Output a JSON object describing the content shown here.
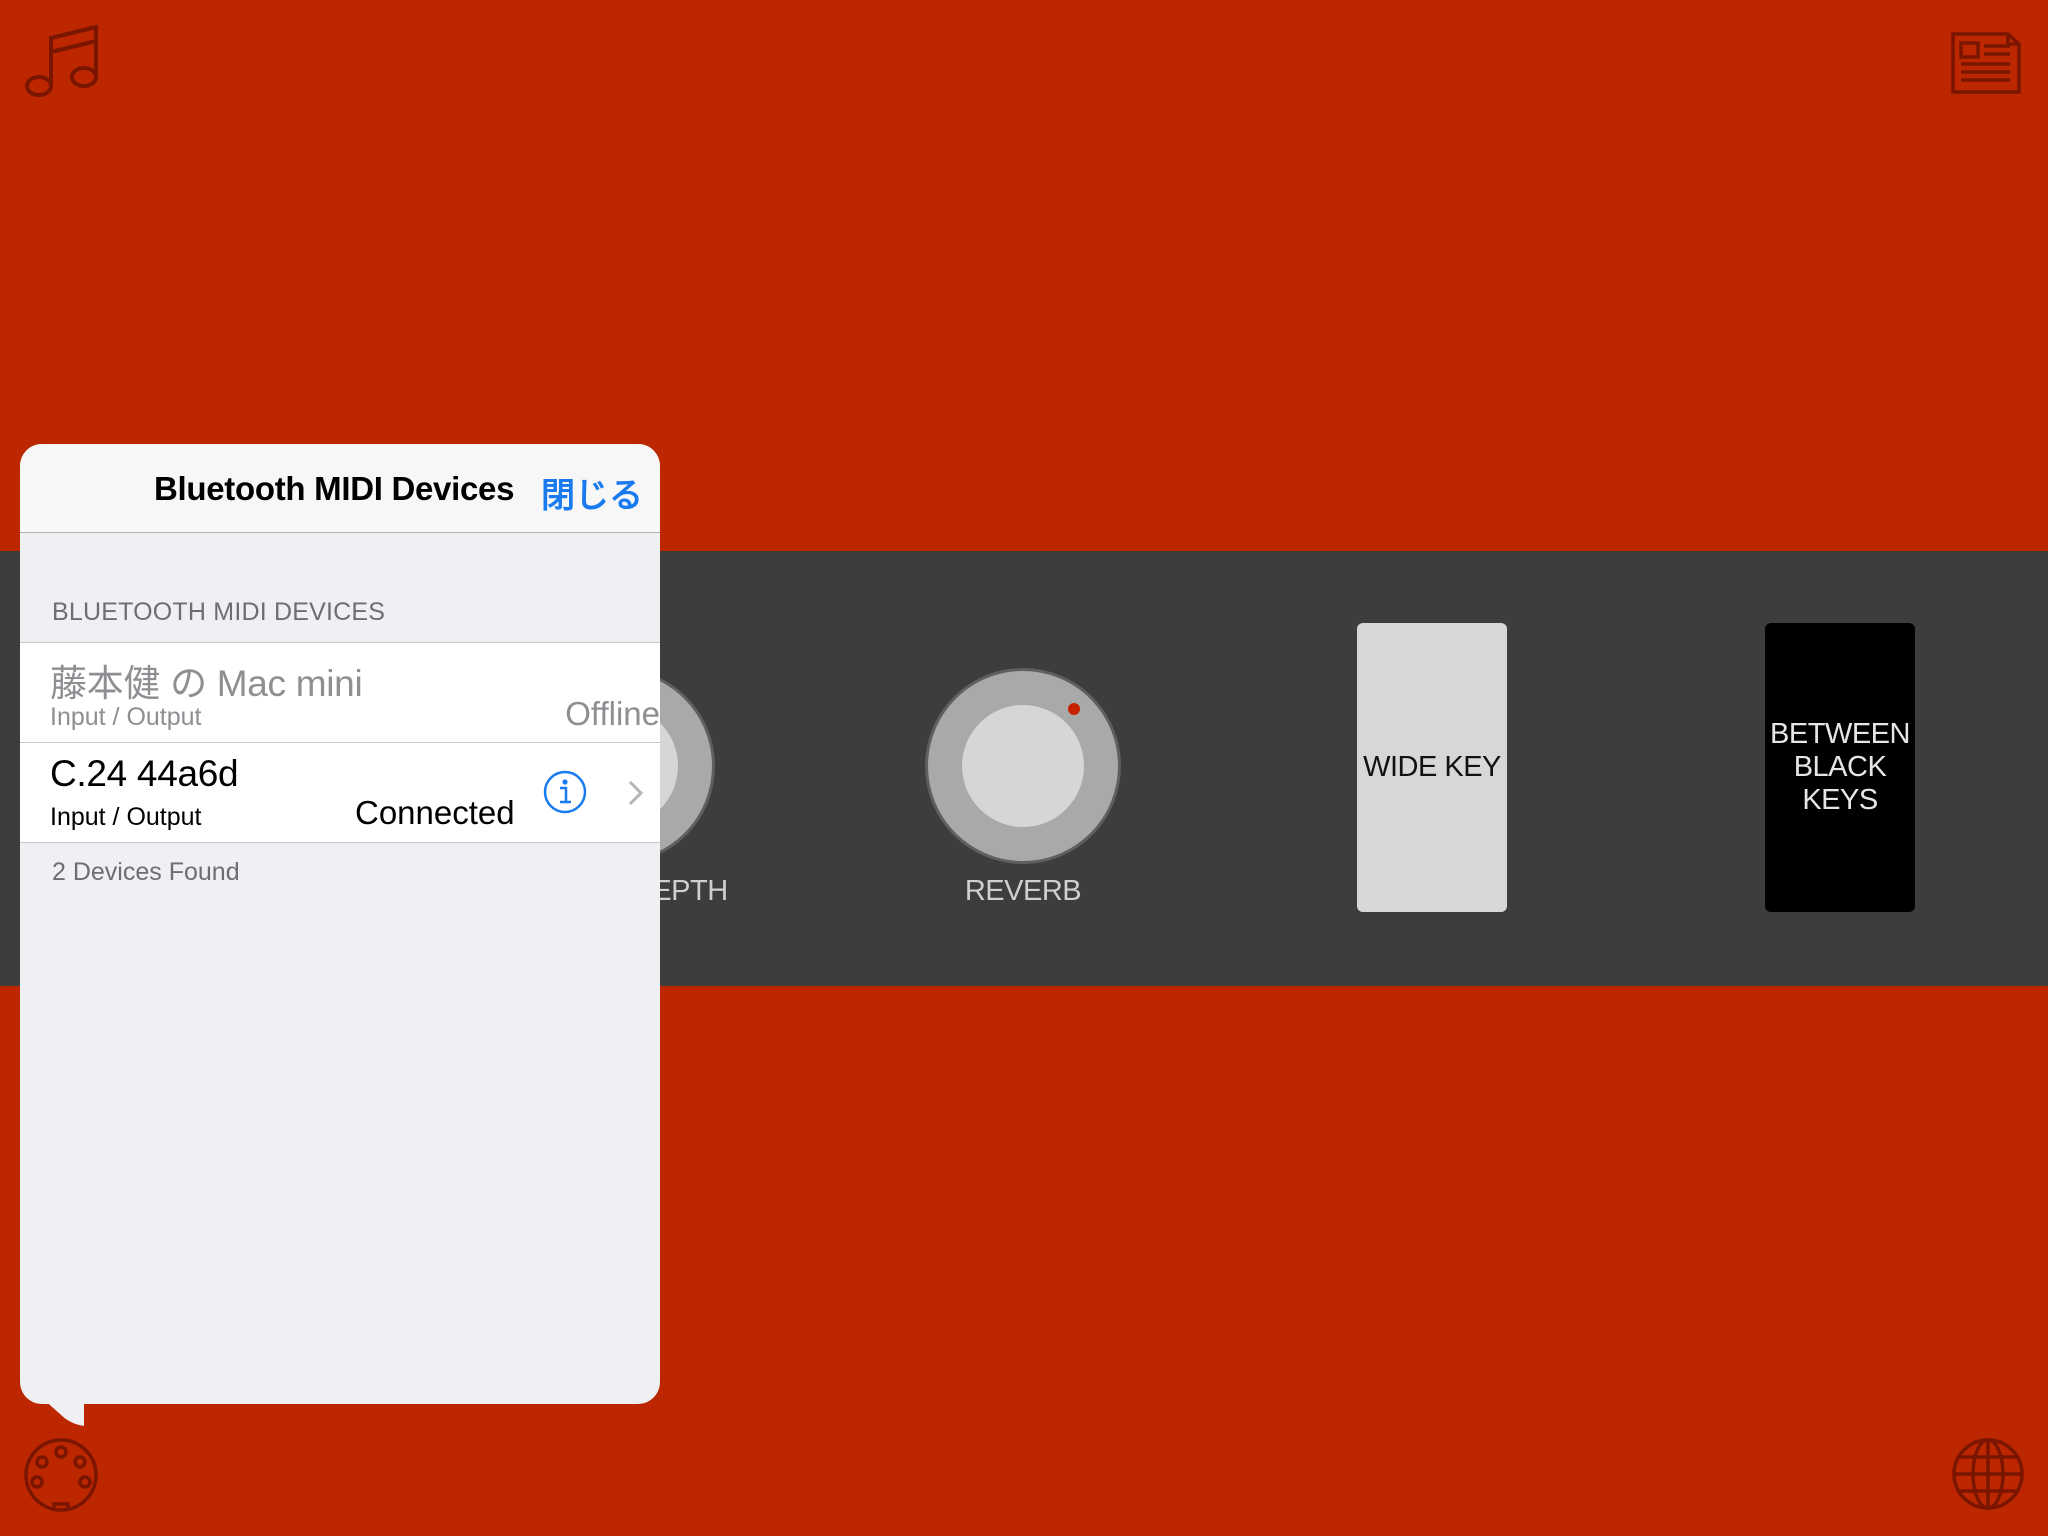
{
  "icons": {
    "music": "music-note-icon",
    "news": "newspaper-icon",
    "midi": "midi-port-icon",
    "globe": "globe-icon",
    "info": "info-icon",
    "chevron": "chevron-right-icon"
  },
  "colors": {
    "background": "#bc2700",
    "strip": "#3d3d3d",
    "accent": "#1a7bf0",
    "icon_stroke": "#7a1500"
  },
  "controls": {
    "depth_label": "EPTH",
    "reverb_label": "REVERB",
    "wide_key_label": "WIDE KEY",
    "black_keys_label": "BETWEEN\nBLACK\nKEYS"
  },
  "popover": {
    "title": "Bluetooth MIDI Devices",
    "close_label": "閉じる",
    "section_header": "BLUETOOTH MIDI DEVICES",
    "devices": [
      {
        "name": "藤本健 の Mac mini",
        "subtitle": "Input / Output",
        "status": "Offline"
      },
      {
        "name": "C.24 44a6d",
        "subtitle": "Input / Output",
        "status": "Connected"
      }
    ],
    "footer": "2 Devices Found"
  }
}
